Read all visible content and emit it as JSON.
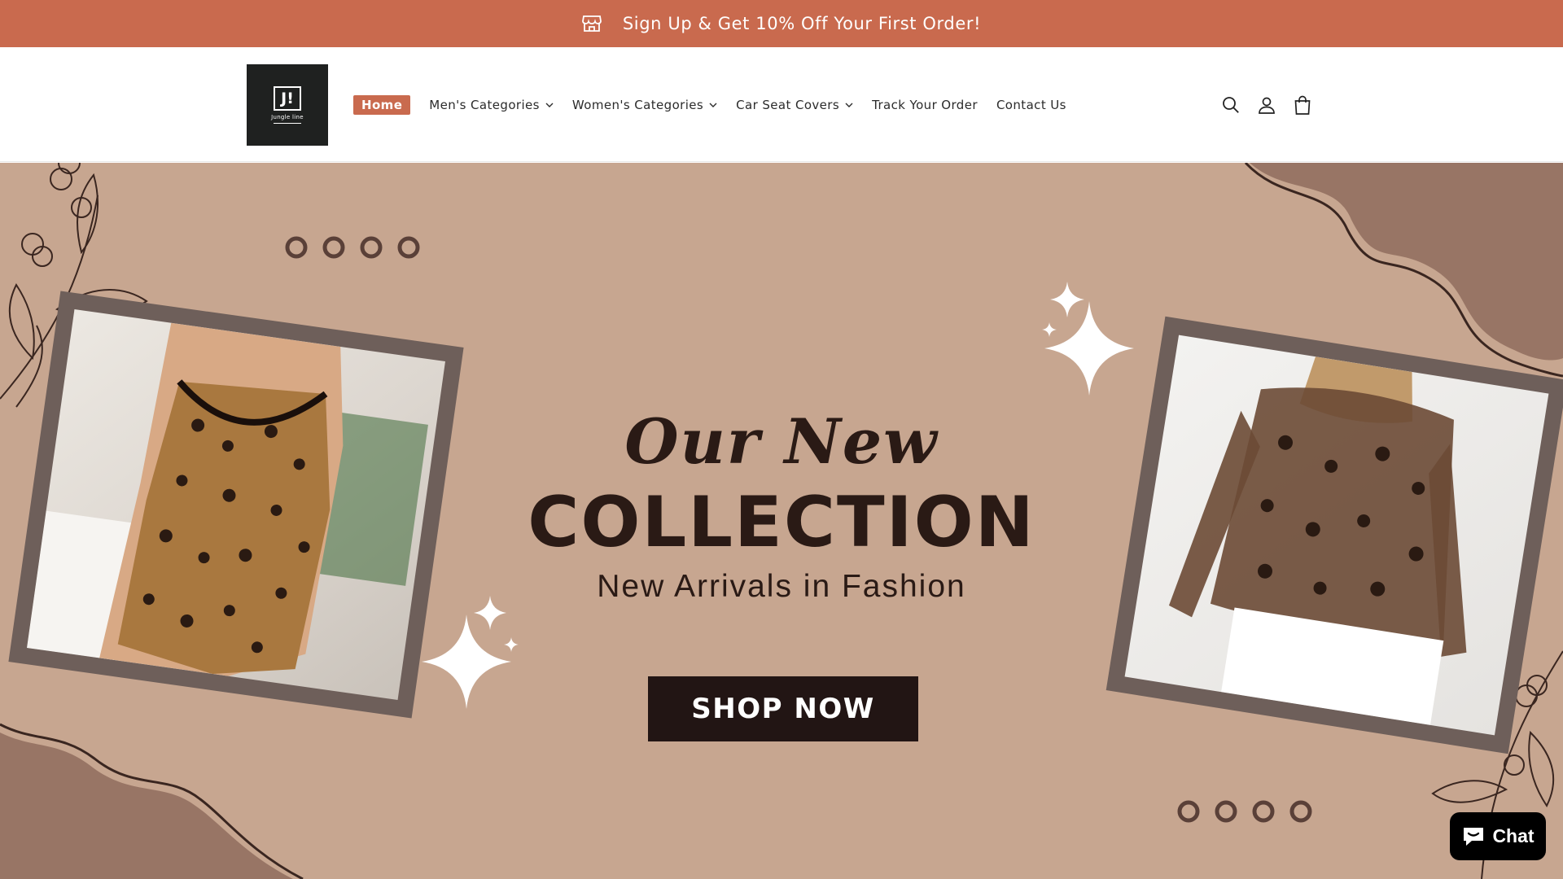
{
  "announcement": {
    "icon": "storefront-icon",
    "text": "Sign Up & Get 10% Off Your First Order!",
    "background": "#c96a4e"
  },
  "header": {
    "logo": {
      "mark": "J!",
      "tagline": "Jungle line"
    },
    "nav": [
      {
        "label": "Home",
        "active": true,
        "dropdown": false
      },
      {
        "label": "Men's Categories",
        "active": false,
        "dropdown": true
      },
      {
        "label": "Women's Categories",
        "active": false,
        "dropdown": true
      },
      {
        "label": "Car Seat Covers",
        "active": false,
        "dropdown": true
      },
      {
        "label": "Track Your Order",
        "active": false,
        "dropdown": false
      },
      {
        "label": "Contact Us",
        "active": false,
        "dropdown": false
      }
    ],
    "icons": [
      "search-icon",
      "account-icon",
      "cart-icon"
    ]
  },
  "hero": {
    "headline_line1": "Our New",
    "headline_line2": "COLLECTION",
    "subheadline": "New Arrivals in Fashion",
    "cta_label": "SHOP NOW",
    "background": "#c7a690"
  },
  "chat_widget": {
    "label": "Chat",
    "icon": "chat-bubble-icon"
  }
}
